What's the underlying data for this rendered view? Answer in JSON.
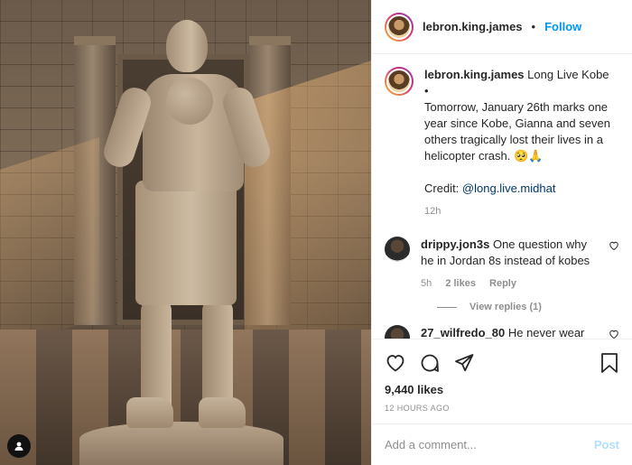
{
  "post": {
    "username": "lebron.king.james",
    "separator": "•",
    "follow_label": "Follow",
    "caption_title": "Long Live Kobe",
    "caption_bullet": "•",
    "caption_body": "Tomorrow, January 26th marks one year since Kobe, Gianna and seven others tragically lost their lives in a helicopter crash. 🥺🙏",
    "credit_label": "Credit:",
    "credit_handle": "@long.live.midhat",
    "caption_time": "12h",
    "likes": "9,440 likes",
    "posted": "12 HOURS AGO"
  },
  "comments": [
    {
      "username": "drippy.jon3s",
      "text": "One question why he in Jordan 8s instead of kobes",
      "time": "5h",
      "likes": "2 likes",
      "reply_label": "Reply",
      "view_replies": "View replies (1)"
    },
    {
      "username": "27_wilfredo_80",
      "text": "He never wear jordans !!!"
    }
  ],
  "comment_box": {
    "placeholder": "Add a comment...",
    "post_label": "Post"
  },
  "icons": {
    "like": "heart-icon",
    "comment": "comment-icon",
    "share": "share-icon",
    "save": "bookmark-icon",
    "tags": "user-tag-icon"
  },
  "colors": {
    "follow": "#0095f6",
    "post_disabled": "#b2dffc",
    "muted": "#8e8e8e"
  }
}
